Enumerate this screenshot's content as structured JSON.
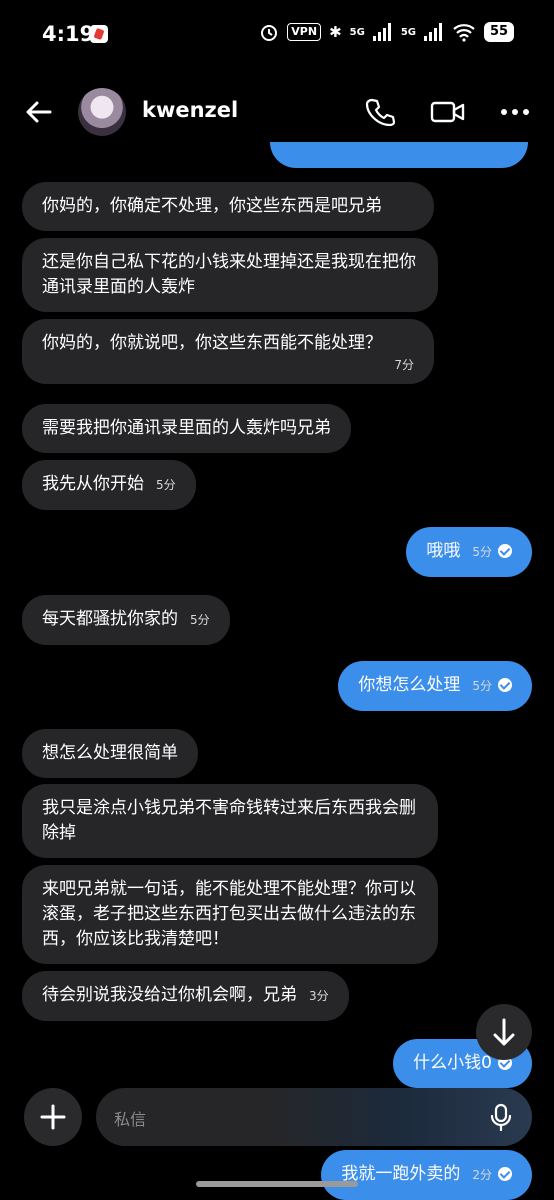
{
  "status_bar": {
    "time": "4:19",
    "vpn": "VPN",
    "bt": "✱",
    "net1": "5G",
    "net2": "5G",
    "battery": "55"
  },
  "header": {
    "username": "kwenzel"
  },
  "messages": [
    {
      "dir": "in",
      "text": "你妈的，你确定不处理，你这些东西是吧兄弟",
      "time": ""
    },
    {
      "dir": "in",
      "text": "还是你自己私下花的小钱来处理掉还是我现在把你通讯录里面的人轰炸",
      "time": ""
    },
    {
      "dir": "in",
      "text": "你妈的，你就说吧，你这些东西能不能处理？",
      "time": "7分"
    },
    {
      "dir": "in",
      "text": "需要我把你通讯录里面的人轰炸吗兄弟",
      "time": ""
    },
    {
      "dir": "in",
      "text": "我先从你开始",
      "time": "5分"
    },
    {
      "dir": "out",
      "text": "哦哦",
      "time": "5分"
    },
    {
      "dir": "in",
      "text": "每天都骚扰你家的",
      "time": "5分"
    },
    {
      "dir": "out",
      "text": "你想怎么处理",
      "time": "5分"
    },
    {
      "dir": "in",
      "text": "想怎么处理很简单",
      "time": ""
    },
    {
      "dir": "in",
      "text": "我只是涂点小钱兄弟不害命钱转过来后东西我会删除掉",
      "time": ""
    },
    {
      "dir": "in",
      "text": "来吧兄弟就一句话，能不能处理不能处理？你可以滚蛋，老子把这些东西打包买出去做什么违法的东西，你应该比我清楚吧！",
      "time": ""
    },
    {
      "dir": "in",
      "text": "待会别说我没给过你机会啊，兄弟",
      "time": "3分"
    },
    {
      "dir": "out",
      "text": "什么小钱0",
      "time": ""
    },
    {
      "dir": "out",
      "text": "我就一跑外卖的",
      "time": "2分"
    }
  ],
  "composer": {
    "placeholder": "私信"
  },
  "colors": {
    "background": "#000000",
    "incoming_bubble": "#262628",
    "outgoing_bubble": "#3b8eea"
  }
}
